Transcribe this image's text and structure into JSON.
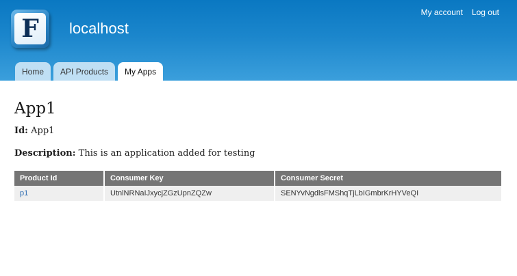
{
  "header": {
    "logo_letter": "F",
    "site_name": "localhost",
    "secondary_menu": [
      {
        "label": "My account"
      },
      {
        "label": "Log out"
      }
    ]
  },
  "tabs": [
    {
      "label": "Home",
      "active": false
    },
    {
      "label": "API Products",
      "active": false
    },
    {
      "label": "My Apps",
      "active": true
    }
  ],
  "app": {
    "title": "App1",
    "id_label": "Id:",
    "id_value": "App1",
    "description_label": "Description:",
    "description_value": "This is an application added for testing"
  },
  "table": {
    "columns": [
      "Product Id",
      "Consumer Key",
      "Consumer Secret"
    ],
    "rows": [
      {
        "product_id": "p1",
        "consumer_key": "UtnlNRNaIJxycjZGzUpnZQZw",
        "consumer_secret": "SENYvNgdlsFMShqTjLbIGmbrKrHYVeQI"
      }
    ]
  },
  "colors": {
    "header_top": "#0a78c2",
    "header_bottom": "#3b9fdc",
    "tab_inactive": "#bfdff4",
    "table_header": "#757575",
    "table_row": "#efefef",
    "link": "#2a6ab0"
  }
}
